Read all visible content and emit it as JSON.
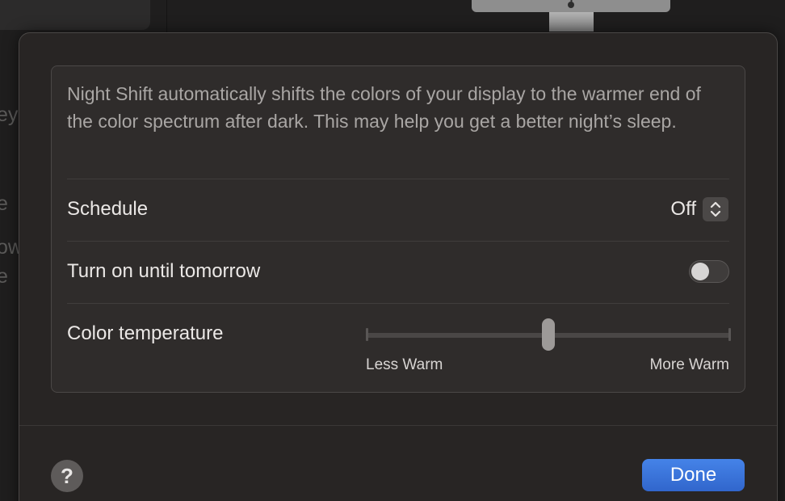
{
  "background": {
    "fragments": [
      "ey",
      "e",
      "ow",
      "e"
    ]
  },
  "night_shift": {
    "description": "Night Shift automatically shifts the colors of your display to the warmer end of the color spectrum after dark. This may help you get a better night’s sleep.",
    "schedule": {
      "label": "Schedule",
      "value": "Off"
    },
    "turn_on": {
      "label": "Turn on until tomorrow",
      "enabled": false
    },
    "color_temperature": {
      "label": "Color temperature",
      "min_label": "Less Warm",
      "max_label": "More Warm",
      "level": 0.5
    }
  },
  "footer": {
    "help_label": "?",
    "done_label": "Done"
  },
  "colors": {
    "accent": "#3c73d9",
    "sheet_bg": "#282524",
    "group_bg": "#2f2c2b"
  }
}
